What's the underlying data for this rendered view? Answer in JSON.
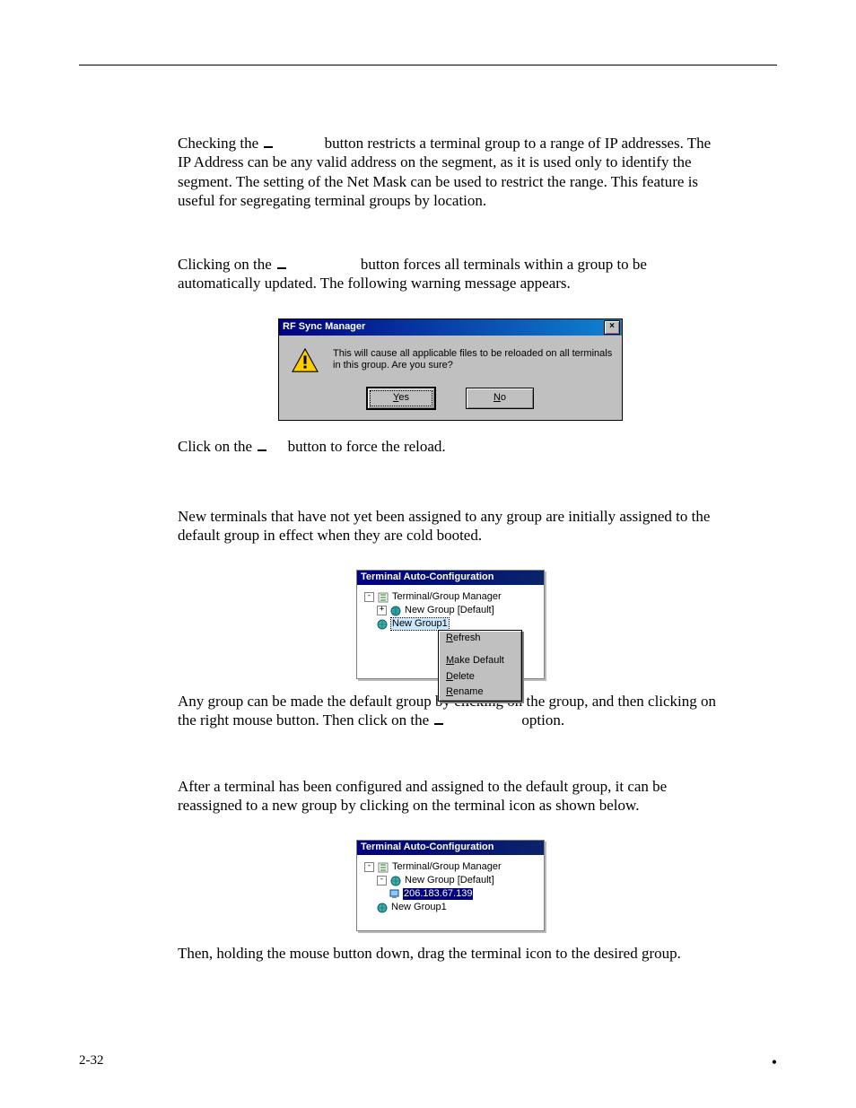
{
  "body": {
    "p1_a": "Checking the ",
    "p1_b": " button restricts a terminal group to a range of IP addresses. The IP Address can be any valid address on the segment, as it is used only to identify the segment. The setting of the Net Mask can be used to restrict the range.  This feature is useful for segregating terminal groups by location.",
    "p2_a": "Clicking on the ",
    "p2_b": " button forces all terminals within a group to be automatically updated. The following warning message appears.",
    "p3_a": "Click on the ",
    "p3_b": " button to force the reload.",
    "p4": "New terminals that have not yet been assigned to any group are initially assigned to the default group in effect when they are cold booted.",
    "p5_a": "Any group can be made the default group by clicking on the group, and then clicking on the right mouse button. Then click on the ",
    "p5_b": " option.",
    "p6": "After a terminal has been configured and assigned to the default group, it can be reassigned to a new group by clicking on the terminal icon as shown below.",
    "p7": "Then, holding the mouse button down, drag the terminal icon to the desired group."
  },
  "dialog1": {
    "title": "RF Sync Manager",
    "message": "This will cause all applicable files to be reloaded on all terminals in this group.  Are you sure?",
    "yes_u": "Y",
    "yes_rest": "es",
    "no_u": "N",
    "no_rest": "o",
    "close": "×"
  },
  "dialog2": {
    "title": "Terminal Auto-Configuration",
    "root": "Terminal/Group Manager",
    "grp_default": "New Group [Default]",
    "grp_selected": "New Group1",
    "menu_refresh_u": "R",
    "menu_refresh_rest": "efresh",
    "menu_make_u": "M",
    "menu_make_rest": "ake Default",
    "menu_delete_u": "D",
    "menu_delete_rest": "elete",
    "menu_rename_u": "R",
    "menu_rename_rest": "ename"
  },
  "dialog3": {
    "title": "Terminal Auto-Configuration",
    "root": "Terminal/Group Manager",
    "grp_default": "New Group [Default]",
    "terminal_ip": "206.183.67.139",
    "grp2": "New Group1"
  },
  "footer": {
    "page": "2-32",
    "bullet": "•"
  }
}
